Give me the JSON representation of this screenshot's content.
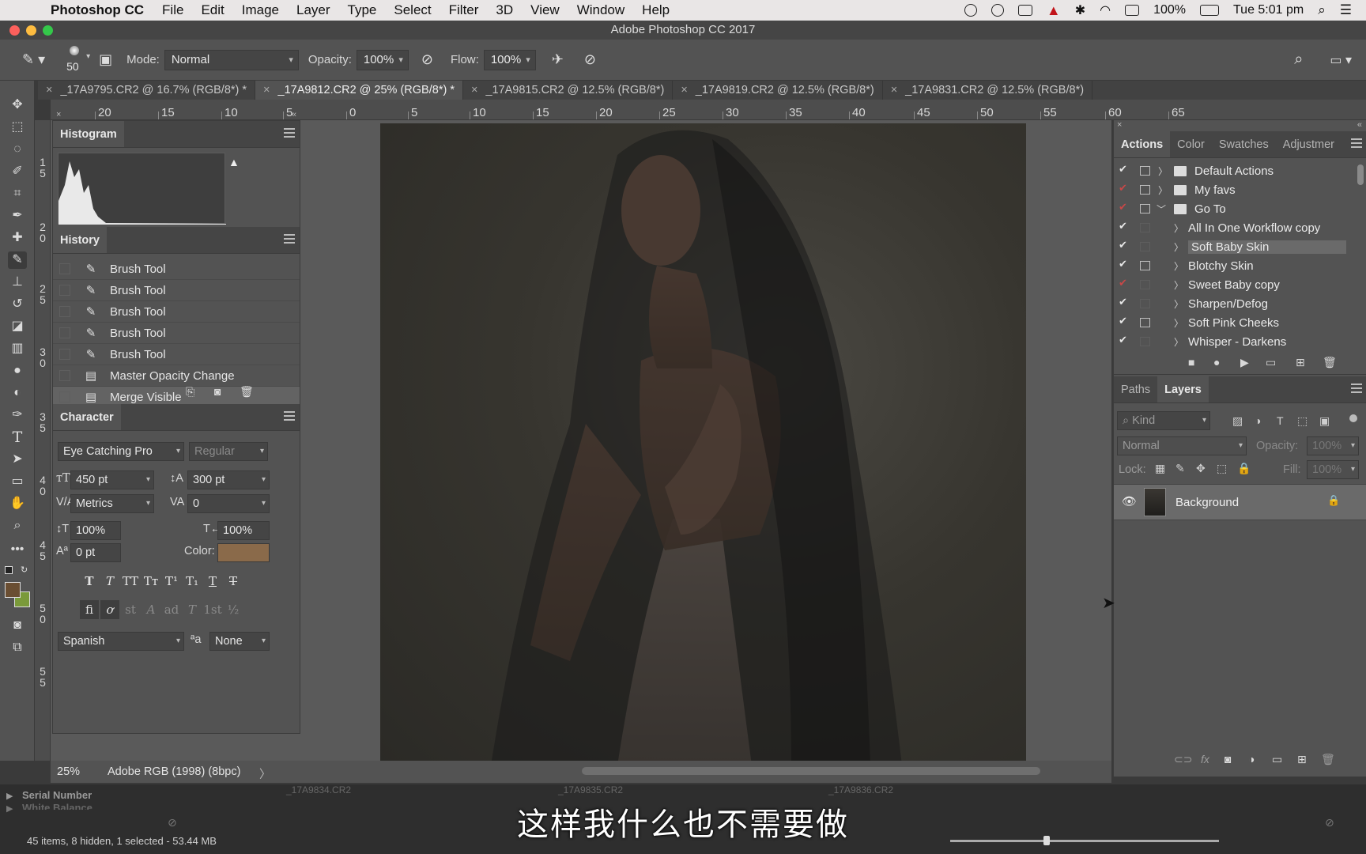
{
  "menubar": {
    "app_name": "Photoshop CC",
    "items": [
      "File",
      "Edit",
      "Image",
      "Layer",
      "Type",
      "Select",
      "Filter",
      "3D",
      "View",
      "Window",
      "Help"
    ],
    "battery": "100%",
    "clock": "Tue 5:01 pm"
  },
  "window": {
    "title": "Adobe Photoshop CC 2017"
  },
  "options": {
    "brush_size": "50",
    "mode_label": "Mode:",
    "mode_value": "Normal",
    "opacity_label": "Opacity:",
    "opacity_value": "100%",
    "flow_label": "Flow:",
    "flow_value": "100%"
  },
  "doc_tabs": [
    "_17A9795.CR2 @ 16.7% (RGB/8*) *",
    "_17A9812.CR2 @ 25% (RGB/8*) *",
    "_17A9815.CR2 @ 12.5% (RGB/8*)",
    "_17A9819.CR2 @ 12.5% (RGB/8*)",
    "_17A9831.CR2 @ 12.5% (RGB/8*)"
  ],
  "ruler_top": [
    "20",
    "15",
    "10",
    "5",
    "0",
    "5",
    "10",
    "15",
    "20",
    "25",
    "30",
    "35",
    "40",
    "45",
    "50",
    "55",
    "60",
    "65"
  ],
  "ruler_left": [
    "1\n5",
    "2\n0",
    "2\n5",
    "3\n0",
    "3\n5",
    "4\n0",
    "4\n5",
    "5\n0",
    "5\n5"
  ],
  "histogram": {
    "tab": "Histogram"
  },
  "history": {
    "tab": "History",
    "items": [
      {
        "label": "Brush Tool",
        "icon": "brush-icon"
      },
      {
        "label": "Brush Tool",
        "icon": "brush-icon"
      },
      {
        "label": "Brush Tool",
        "icon": "brush-icon"
      },
      {
        "label": "Brush Tool",
        "icon": "brush-icon"
      },
      {
        "label": "Brush Tool",
        "icon": "brush-icon"
      },
      {
        "label": "Master Opacity Change",
        "icon": "document-icon"
      },
      {
        "label": "Merge Visible",
        "icon": "document-icon"
      }
    ]
  },
  "character": {
    "tab": "Character",
    "font_family": "Eye Catching Pro",
    "font_style": "Regular",
    "font_size": "450 pt",
    "leading": "300 pt",
    "kerning": "Metrics",
    "tracking": "0",
    "vertical_scale": "100%",
    "horizontal_scale": "100%",
    "baseline_shift": "0 pt",
    "color_label": "Color:",
    "color_swatch": "#8a6a4a",
    "language": "Spanish",
    "antialias_label": "ªa",
    "antialias": "None",
    "style_buttons": [
      "T",
      "T",
      "TT",
      "Tт",
      "T¹",
      "T₁",
      "T",
      "T"
    ],
    "opentype_buttons": [
      "fi",
      "ơ",
      "st",
      "A",
      "ad",
      "T",
      "1st",
      "½"
    ]
  },
  "actions_panel": {
    "tabs": [
      "Actions",
      "Color",
      "Swatches",
      "Adjustmer"
    ],
    "rows": [
      {
        "label": "Default Actions",
        "type": "set",
        "tick": "white",
        "dialog": true
      },
      {
        "label": "My favs",
        "type": "set",
        "tick": "red",
        "dialog": true
      },
      {
        "label": "Go To",
        "type": "set-open",
        "tick": "red",
        "dialog": true
      },
      {
        "label": "All In One Workflow copy",
        "type": "action",
        "tick": "white",
        "dialog": false
      },
      {
        "label": "Soft Baby Skin",
        "type": "action",
        "tick": "white",
        "dialog": false,
        "selected": true
      },
      {
        "label": "Blotchy Skin",
        "type": "action",
        "tick": "white",
        "dialog": true
      },
      {
        "label": "Sweet Baby copy",
        "type": "action",
        "tick": "red",
        "dialog": false
      },
      {
        "label": "Sharpen/Defog",
        "type": "action",
        "tick": "white",
        "dialog": false
      },
      {
        "label": "Soft Pink Cheeks",
        "type": "action",
        "tick": "white",
        "dialog": true
      },
      {
        "label": "Whisper - Darkens",
        "type": "action",
        "tick": "white",
        "dialog": false
      }
    ]
  },
  "layers_panel": {
    "tabs": [
      "Paths",
      "Layers"
    ],
    "kind_placeholder": "Kind",
    "blend_mode": "Normal",
    "opacity_label": "Opacity:",
    "opacity_value": "100%",
    "lock_label": "Lock:",
    "fill_label": "Fill:",
    "fill_value": "100%",
    "layers": [
      {
        "name": "Background",
        "visible": true,
        "locked": true
      }
    ]
  },
  "status": {
    "zoom": "25%",
    "profile": "Adobe RGB (1998) (8bpc)"
  },
  "bridge": {
    "serial_label": "Serial Number",
    "wb_label": "White Balance",
    "items_summary": "45 items, 8 hidden, 1 selected - 53.44 MB",
    "thumb_labels": [
      "_17A9834.CR2",
      "_17A9835.CR2",
      "_17A9836.CR2"
    ]
  },
  "subtitle": "这样我什么也不需要做"
}
